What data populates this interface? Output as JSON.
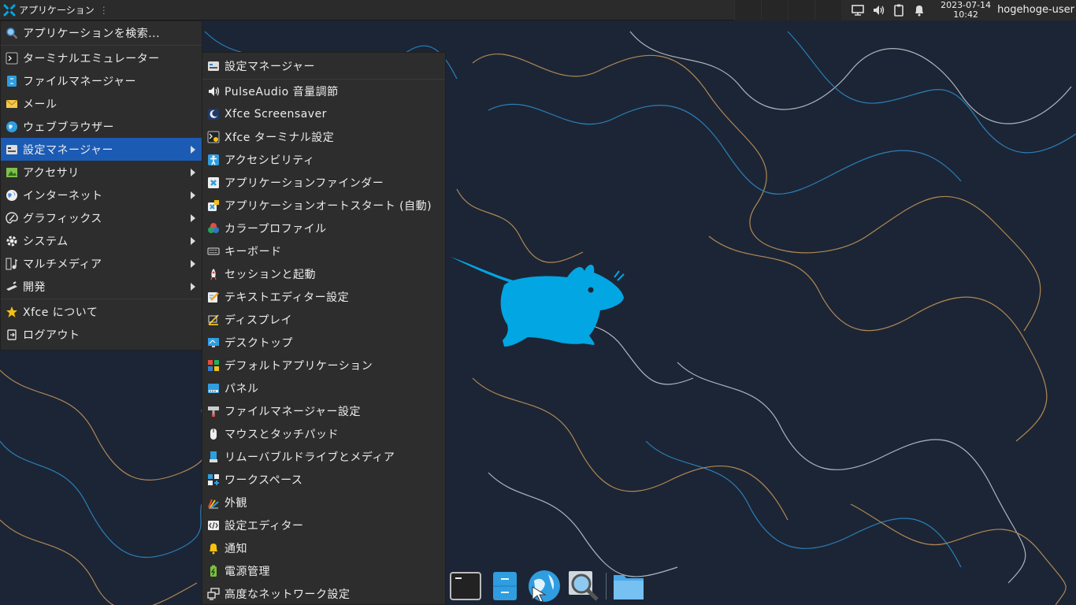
{
  "top_panel": {
    "apps_label": "アプリケーション",
    "clock_date": "2023-07-14",
    "clock_time": "10:42",
    "username": "hogehoge-user"
  },
  "main_menu": {
    "items": [
      {
        "label": "アプリケーションを検索...",
        "icon": "search-icon",
        "submenu": false
      },
      {
        "label": "ターミナルエミュレーター",
        "icon": "terminal-icon",
        "submenu": false
      },
      {
        "label": "ファイルマネージャー",
        "icon": "file-manager-icon",
        "submenu": false
      },
      {
        "label": "メール",
        "icon": "mail-icon",
        "submenu": false
      },
      {
        "label": "ウェブブラウザー",
        "icon": "web-browser-icon",
        "submenu": false
      },
      {
        "label": "設定マネージャー",
        "icon": "settings-manager-icon",
        "submenu": true,
        "active": true
      },
      {
        "label": "アクセサリ",
        "icon": "accessories-icon",
        "submenu": true
      },
      {
        "label": "インターネット",
        "icon": "internet-icon",
        "submenu": true
      },
      {
        "label": "グラフィックス",
        "icon": "graphics-icon",
        "submenu": true
      },
      {
        "label": "システム",
        "icon": "system-icon",
        "submenu": true
      },
      {
        "label": "マルチメディア",
        "icon": "multimedia-icon",
        "submenu": true
      },
      {
        "label": "開発",
        "icon": "development-icon",
        "submenu": true
      },
      {
        "label": "Xfce について",
        "icon": "star-icon",
        "submenu": false
      },
      {
        "label": "ログアウト",
        "icon": "logout-icon",
        "submenu": false
      }
    ]
  },
  "sub_menu": {
    "items": [
      {
        "label": "設定マネージャー",
        "icon": "settings-manager-icon"
      },
      {
        "label": "PulseAudio 音量調節",
        "icon": "volume-icon"
      },
      {
        "label": "Xfce Screensaver",
        "icon": "screensaver-icon"
      },
      {
        "label": "Xfce ターミナル設定",
        "icon": "terminal-settings-icon"
      },
      {
        "label": "アクセシビリティ",
        "icon": "accessibility-icon"
      },
      {
        "label": "アプリケーションファインダー",
        "icon": "app-finder-icon"
      },
      {
        "label": "アプリケーションオートスタート (自動)",
        "icon": "autostart-icon"
      },
      {
        "label": "カラープロファイル",
        "icon": "color-profile-icon"
      },
      {
        "label": "キーボード",
        "icon": "keyboard-icon"
      },
      {
        "label": "セッションと起動",
        "icon": "session-icon"
      },
      {
        "label": "テキストエディター設定",
        "icon": "text-editor-icon"
      },
      {
        "label": "ディスプレイ",
        "icon": "display-icon"
      },
      {
        "label": "デスクトップ",
        "icon": "desktop-icon"
      },
      {
        "label": "デフォルトアプリケーション",
        "icon": "default-apps-icon"
      },
      {
        "label": "パネル",
        "icon": "panel-icon"
      },
      {
        "label": "ファイルマネージャー設定",
        "icon": "file-manager-settings-icon"
      },
      {
        "label": "マウスとタッチパッド",
        "icon": "mouse-icon"
      },
      {
        "label": "リムーバブルドライブとメディア",
        "icon": "removable-drive-icon"
      },
      {
        "label": "ワークスペース",
        "icon": "workspaces-icon"
      },
      {
        "label": "外観",
        "icon": "appearance-icon"
      },
      {
        "label": "設定エディター",
        "icon": "settings-editor-icon"
      },
      {
        "label": "通知",
        "icon": "notifications-icon"
      },
      {
        "label": "電源管理",
        "icon": "power-manager-icon"
      },
      {
        "label": "高度なネットワーク設定",
        "icon": "network-settings-icon"
      }
    ]
  },
  "dock": {
    "items": [
      "terminal-icon",
      "file-manager-icon",
      "web-browser-icon",
      "app-finder-icon",
      "folder-icon"
    ]
  },
  "colors": {
    "desktop_bg": "#1c2535",
    "mouse_logo": "#02a6e3",
    "menu_bg": "#2d2d2d",
    "menu_highlight": "#1c5bb3",
    "panel_bg": "#2b2b2b"
  }
}
